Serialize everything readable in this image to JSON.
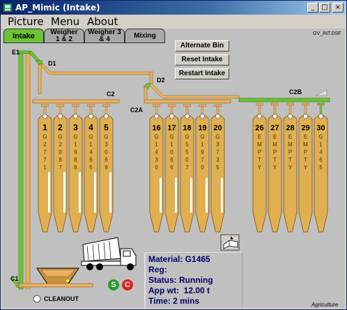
{
  "window": {
    "title": "AP_Mimic (Intake)"
  },
  "menu": [
    "Picture",
    "Menu",
    "About"
  ],
  "tabs": [
    "Intake",
    "Weigher\n1 & 2",
    "Weigher 3\n& 4",
    "Mixing"
  ],
  "screen_id": "GV_INT.DSF",
  "controls": {
    "alternate_bin": "Alternate Bin",
    "reset_intake": "Reset Intake",
    "restart_intake": "Restart Intake"
  },
  "equipment": {
    "e1": "E1",
    "d1": "D1",
    "d2": "D2",
    "c1": "C1",
    "c2": "C2",
    "c2a": "C2A",
    "c2b": "C2B",
    "cleanout": "CLEANOUT",
    "s_button": "S",
    "c_button": "C"
  },
  "bins": [
    {
      "num": "1",
      "content": "G2771",
      "level": 0.72
    },
    {
      "num": "2",
      "content": "G2087",
      "level": 0.72
    },
    {
      "num": "3",
      "content": "G1988",
      "level": 0.72
    },
    {
      "num": "4",
      "content": "G1465",
      "level": 0.72
    },
    {
      "num": "5",
      "content": "G3069",
      "level": 0.72
    },
    {
      "num": "16",
      "content": "G1430",
      "level": 0.62
    },
    {
      "num": "17",
      "content": "G1066",
      "level": 0.62
    },
    {
      "num": "18",
      "content": "G5507",
      "level": 0.62
    },
    {
      "num": "19",
      "content": "G1970",
      "level": 0.62
    },
    {
      "num": "20",
      "content": "G3735",
      "level": 0.62
    },
    {
      "num": "26",
      "content": "EMPTY",
      "level": 0
    },
    {
      "num": "27",
      "content": "EMPTY",
      "level": 0
    },
    {
      "num": "28",
      "content": "EMPTY",
      "level": 0
    },
    {
      "num": "29",
      "content": "EMPTY",
      "level": 0
    },
    {
      "num": "30",
      "content": "G1465",
      "level": 0
    }
  ],
  "status": {
    "material": "Material: G1465",
    "reg": "Reg:",
    "status": "Status: Running",
    "app_wt": "App wt:  12.00 t",
    "time": "Time: 2 mins"
  },
  "watermark": "Agriculture",
  "colors": {
    "pipe": "#e8b060",
    "bin": "#e0b050",
    "active_green": "#6cc434",
    "title_blue": "#0a246a"
  }
}
